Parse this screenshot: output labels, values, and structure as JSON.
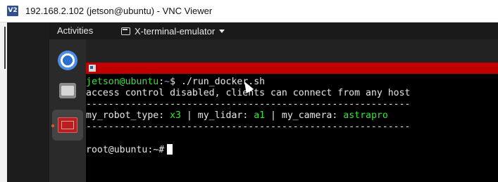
{
  "window": {
    "logo_text": "V2",
    "title": "192.168.2.102 (jetson@ubuntu) - VNC Viewer"
  },
  "topbar": {
    "activities": "Activities",
    "app_name": "X-terminal-emulator"
  },
  "dock": {
    "items": [
      "chromium-icon",
      "files-icon",
      "terminal-icon"
    ]
  },
  "terminal": {
    "prompt1_user": "jetson@ubuntu",
    "prompt1_colon": ":",
    "prompt1_path": "~",
    "prompt1_cmd": "$ ./run_docker.sh",
    "line2": "access control disabled, clients can connect from any host",
    "divider": "----------------------------------------------------------",
    "config_robot_label": "my_robot_type: ",
    "config_robot_value": "x3",
    "config_lidar_label": " | my_lidar: ",
    "config_lidar_value": "a1",
    "config_camera_label": " | my_camera: ",
    "config_camera_value": "astrapro",
    "root_prompt": "root@ubuntu:~#"
  },
  "colors": {
    "terminal_title_bar": "#c00000",
    "prompt_green": "#34e234",
    "path_blue": "#729fcf"
  }
}
